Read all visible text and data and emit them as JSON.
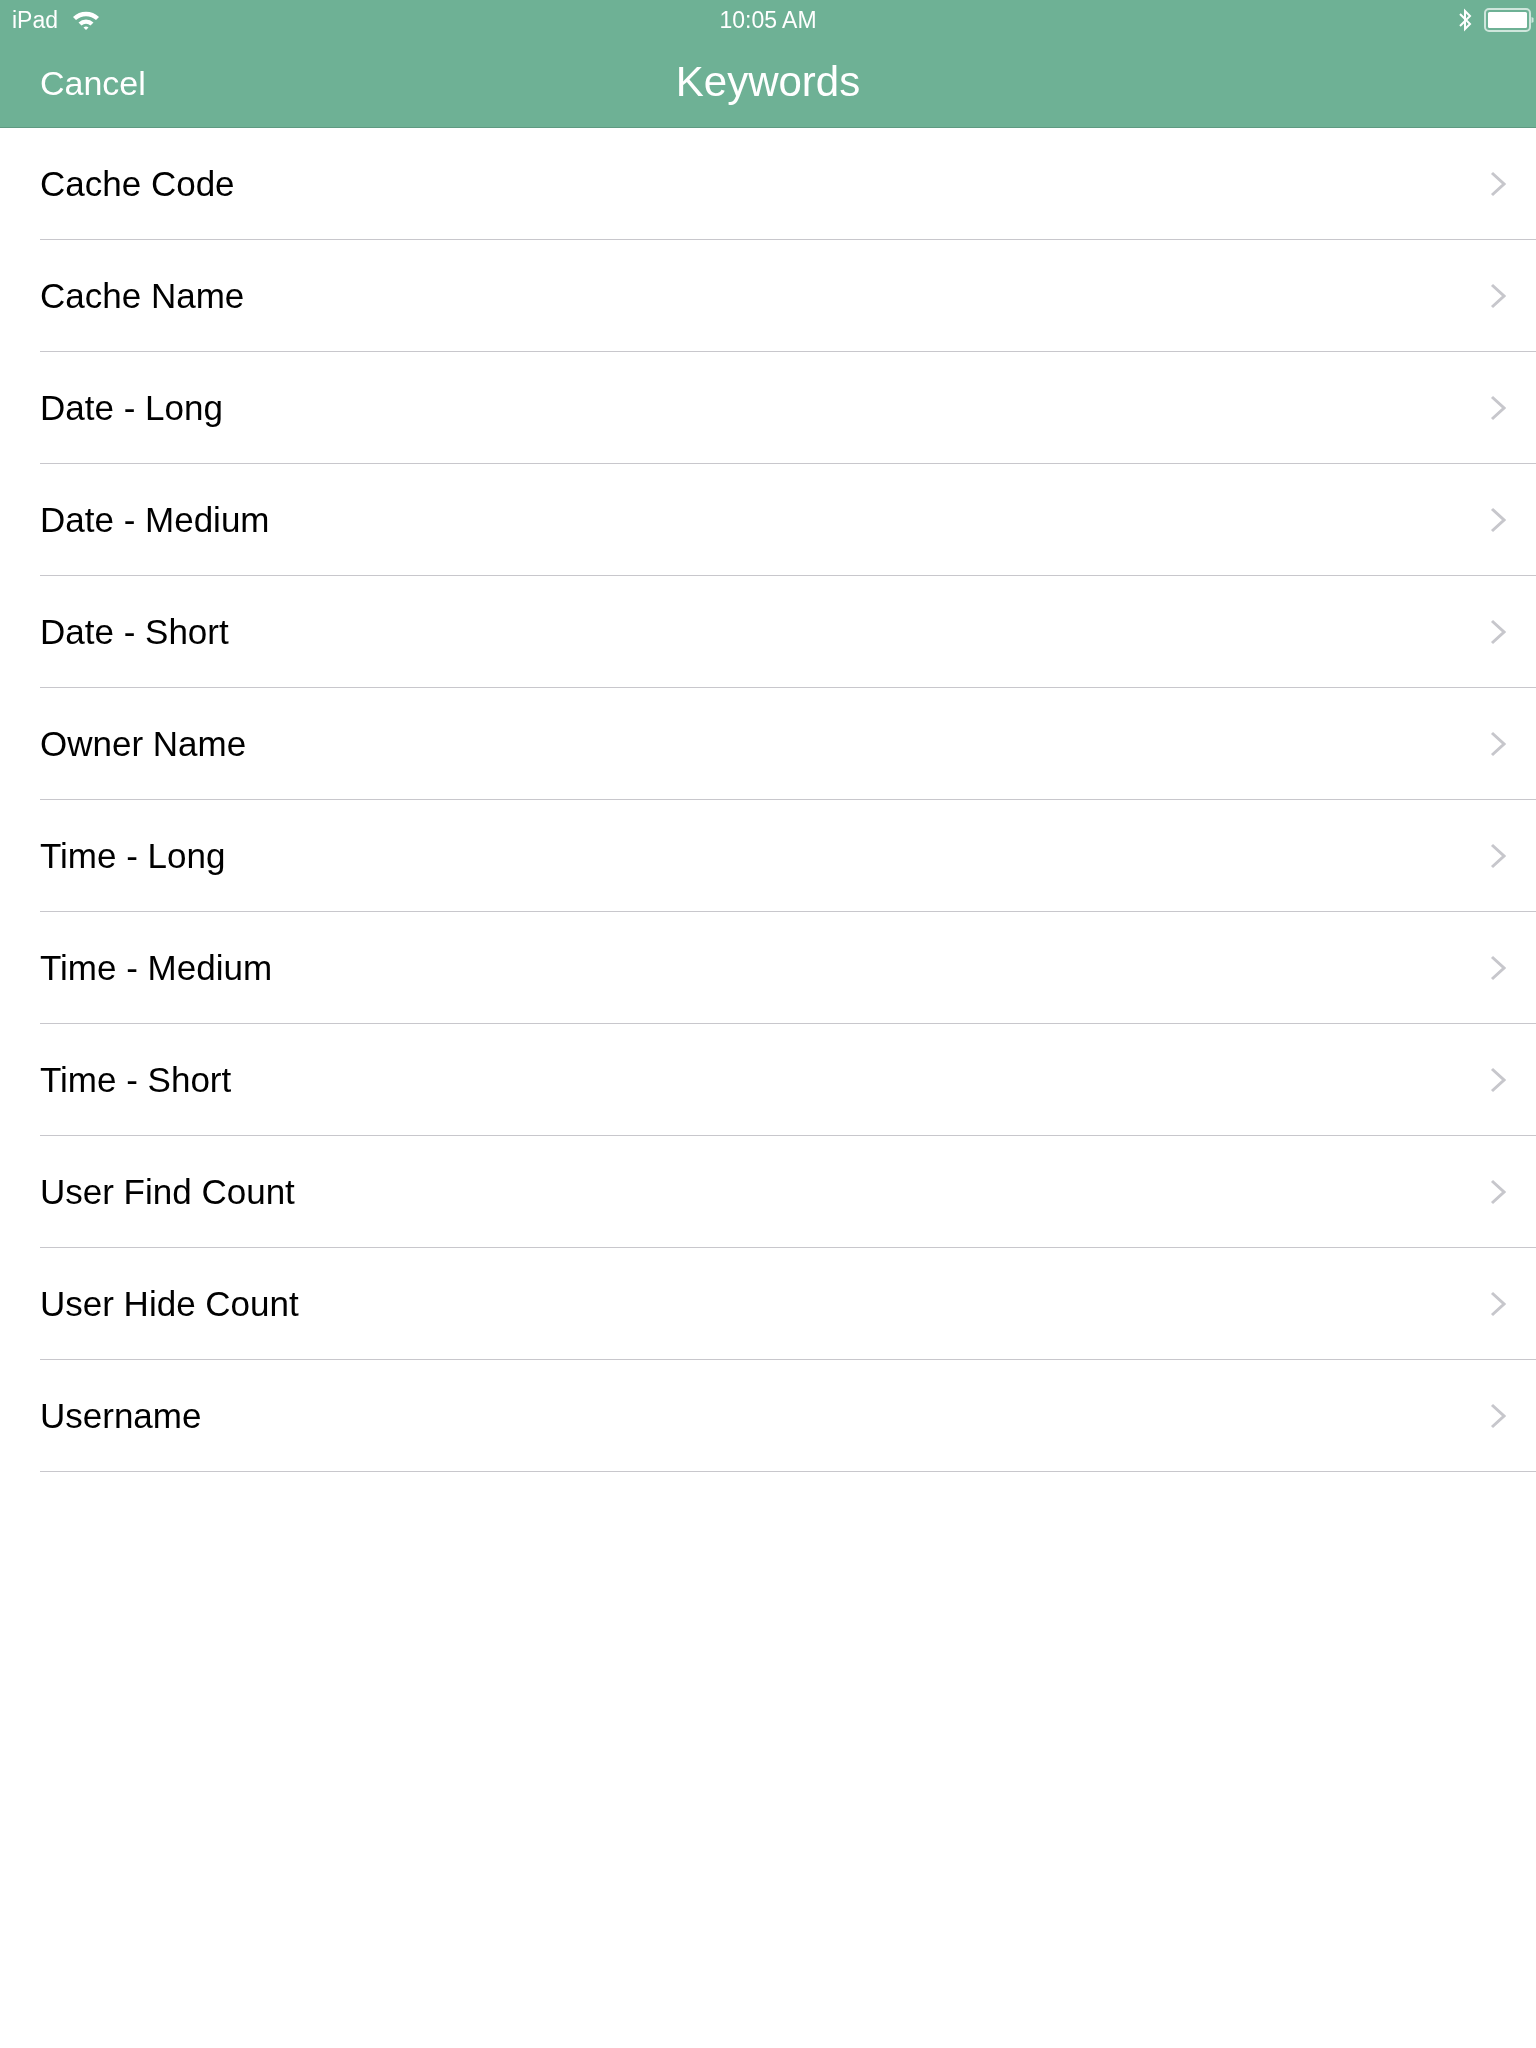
{
  "status_bar": {
    "device": "iPad",
    "time": "10:05 AM"
  },
  "nav_bar": {
    "cancel": "Cancel",
    "title": "Keywords"
  },
  "items": [
    {
      "label": "Cache Code"
    },
    {
      "label": "Cache Name"
    },
    {
      "label": "Date - Long"
    },
    {
      "label": "Date - Medium"
    },
    {
      "label": "Date - Short"
    },
    {
      "label": "Owner Name"
    },
    {
      "label": "Time - Long"
    },
    {
      "label": "Time - Medium"
    },
    {
      "label": "Time - Short"
    },
    {
      "label": "User Find Count"
    },
    {
      "label": "User Hide Count"
    },
    {
      "label": "Username"
    }
  ]
}
